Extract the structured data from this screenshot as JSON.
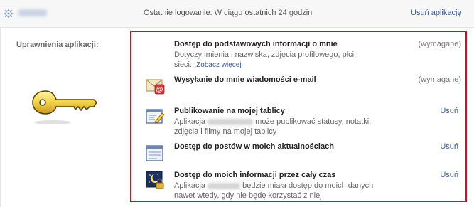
{
  "header": {
    "last_login": "Ostatnie logowanie: W ciągu ostatnich 24 godzin",
    "remove_app": "Usuń aplikację"
  },
  "permissions_label": "Uprawnienia aplikacji:",
  "permissions": [
    {
      "title": "Dostęp do podstawowych informacji o mnie",
      "desc_text": "Dotyczy imienia i nazwiska, zdjęcia profilowego, płci, sieci...",
      "more_link": "Zobacz więcej",
      "status": "(wymagane)",
      "icon": "none"
    },
    {
      "title": "Wysyłanie do mnie wiadomości e-mail",
      "status": "(wymagane)",
      "icon": "email-icon"
    },
    {
      "title": "Publikowanie na mojej tablicy",
      "desc_prefix": "Aplikacja",
      "desc_suffix": "może publikować statusy, notatki, zdjęcia i filmy na mojej tablicy",
      "action": "Usuń",
      "icon": "wall-post-icon"
    },
    {
      "title": "Dostęp do postów w moich aktualnościach",
      "action": "Usuń",
      "icon": "news-feed-icon"
    },
    {
      "title": "Dostęp do moich informacji przez cały czas",
      "desc_prefix": "Aplikacja",
      "desc_suffix": "będzie miała dostęp do moich danych nawet wtedy, gdy nie będę korzystać z niej",
      "action": "Usuń",
      "icon": "offline-access-icon"
    }
  ],
  "colors": {
    "highlight_border": "#c8102e",
    "link": "#3b5998",
    "key_fill": "#f2d14a"
  }
}
